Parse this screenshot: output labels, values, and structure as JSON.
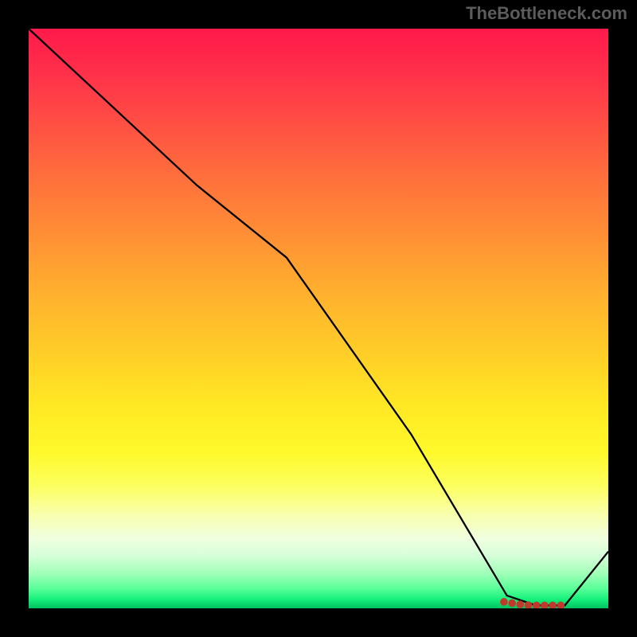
{
  "attribution": "TheBottleneck.com",
  "chart_data": {
    "type": "line",
    "title": "",
    "xlabel": "",
    "ylabel": "",
    "xlim": [
      0,
      100
    ],
    "ylim": [
      0,
      100
    ],
    "series": [
      {
        "name": "line",
        "x": [
          0,
          29,
          44.5,
          66,
          82.5,
          87.5,
          92.5,
          100
        ],
        "y": [
          100,
          73,
          60.5,
          30,
          2.2,
          0.5,
          0.5,
          9.8
        ]
      }
    ],
    "markers": {
      "name": "series-markers",
      "color": "#c0392b",
      "points": [
        {
          "x": 82.0,
          "y": 1.12
        },
        {
          "x": 83.4,
          "y": 0.9
        },
        {
          "x": 84.8,
          "y": 0.68
        },
        {
          "x": 86.2,
          "y": 0.55
        },
        {
          "x": 87.6,
          "y": 0.5
        },
        {
          "x": 89.0,
          "y": 0.5
        },
        {
          "x": 90.4,
          "y": 0.5
        },
        {
          "x": 91.8,
          "y": 0.5
        }
      ]
    },
    "background_gradient": {
      "top": "#ff1a4b",
      "mid": "#ffe824",
      "bottom": "#00c060"
    }
  }
}
